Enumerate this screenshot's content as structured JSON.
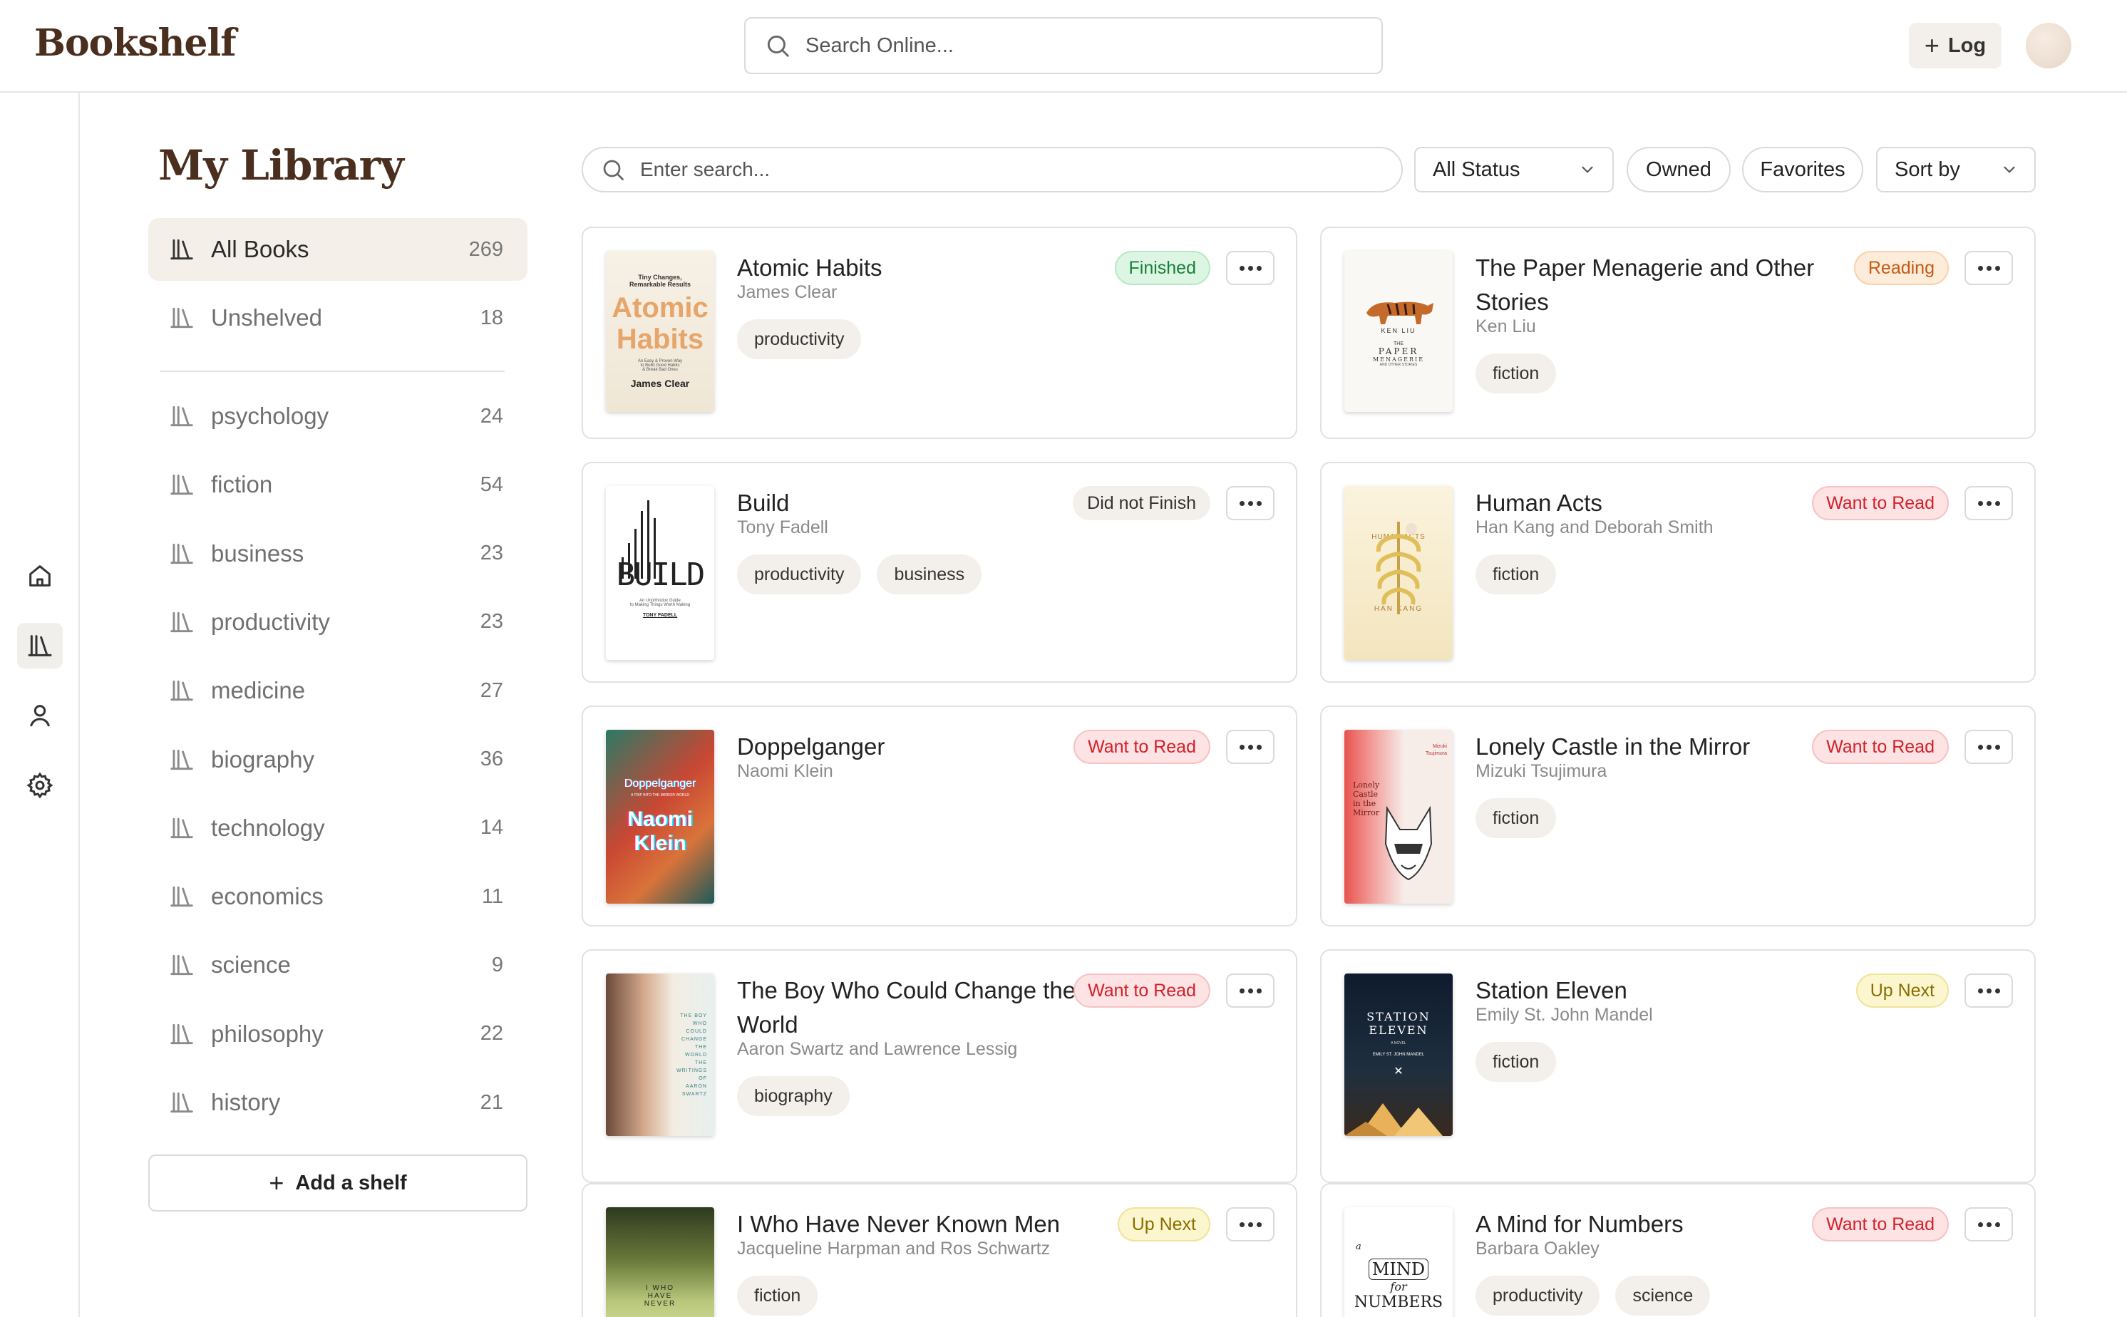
{
  "app": {
    "brand": "Bookshelf",
    "search_placeholder": "Search Online...",
    "log_label": "Log",
    "log_icon": "plus-icon"
  },
  "rail": {
    "items": [
      {
        "name": "home",
        "icon": "home-icon"
      },
      {
        "name": "library",
        "icon": "library-icon",
        "active": true
      },
      {
        "name": "profile",
        "icon": "user-icon"
      },
      {
        "name": "settings",
        "icon": "gear-icon"
      }
    ]
  },
  "sidebar": {
    "title": "My Library",
    "primary": [
      {
        "label": "All Books",
        "count": "269",
        "active": true
      },
      {
        "label": "Unshelved",
        "count": "18"
      }
    ],
    "shelves": [
      {
        "label": "psychology",
        "count": "24"
      },
      {
        "label": "fiction",
        "count": "54"
      },
      {
        "label": "business",
        "count": "23"
      },
      {
        "label": "productivity",
        "count": "23"
      },
      {
        "label": "medicine",
        "count": "27"
      },
      {
        "label": "biography",
        "count": "36"
      },
      {
        "label": "technology",
        "count": "14"
      },
      {
        "label": "economics",
        "count": "11"
      },
      {
        "label": "science",
        "count": "9"
      },
      {
        "label": "philosophy",
        "count": "22"
      },
      {
        "label": "history",
        "count": "21"
      }
    ],
    "add_label": "Add a shelf"
  },
  "filters": {
    "search_placeholder": "Enter search...",
    "status_value": "All Status",
    "owned_label": "Owned",
    "favorites_label": "Favorites",
    "sort_label": "Sort by"
  },
  "colors": {
    "brand": "#4a2f1f",
    "finished_bg": "#dcf6e3",
    "finished_text": "#1a7f3a",
    "finished_border": "#b7e8c5",
    "reading_bg": "#fdecd9",
    "reading_text": "#c45a14",
    "reading_border": "#f8d2ad",
    "dnf_bg": "#f3f0ec",
    "dnf_text": "#333333",
    "want_bg": "#fde3e3",
    "want_text": "#d1212a",
    "want_border": "#f6c2c2",
    "upnext_bg": "#fcf6cf",
    "upnext_text": "#8a6d00",
    "upnext_border": "#f0e39a"
  },
  "books": [
    {
      "title": "Atomic Habits",
      "author": "James Clear",
      "status": "Finished",
      "status_kind": "finished",
      "tags": [
        "productivity"
      ],
      "cover": {
        "lines": [
          "Tiny Changes,",
          "Remarkable Results",
          "Atomic",
          "Habits",
          "An Easy & Proven Way",
          "to Build Good Habits",
          "& Break Bad Ones",
          "James Clear"
        ]
      }
    },
    {
      "title": "The Paper Menagerie and Other Stories",
      "author": "Ken Liu",
      "status": "Reading",
      "status_kind": "reading",
      "tags": [
        "fiction"
      ],
      "cover": {
        "lines": [
          "KEN LIU",
          "THE",
          "PAPER",
          "MENAGERIE",
          "AND OTHER STORIES"
        ]
      }
    },
    {
      "title": "Build",
      "author": "Tony Fadell",
      "status": "Did not Finish",
      "status_kind": "dnf",
      "tags": [
        "productivity",
        "business"
      ],
      "cover": {
        "lines": [
          "BUILD",
          "An Unorthodox Guide",
          "to Making Things Worth Making",
          "TONY FADELL"
        ]
      }
    },
    {
      "title": "Human Acts",
      "author": "Han Kang and Deborah Smith",
      "status": "Want to Read",
      "status_kind": "want",
      "tags": [
        "fiction"
      ],
      "cover": {
        "lines": [
          "HUMAN ACTS",
          "HAN KANG"
        ]
      }
    },
    {
      "title": "Doppelganger",
      "author": "Naomi Klein",
      "status": "Want to Read",
      "status_kind": "want",
      "tags": [],
      "cover": {
        "lines": [
          "Doppelganger",
          "A TRIP INTO THE MIRROR WORLD",
          "Naomi",
          "Klein"
        ]
      }
    },
    {
      "title": "Lonely Castle in the Mirror",
      "author": "Mizuki Tsujimura",
      "status": "Want to Read",
      "status_kind": "want",
      "tags": [
        "fiction"
      ],
      "cover": {
        "lines": [
          "Lonely",
          "Castle",
          "in the",
          "Mirror",
          "Mizuki",
          "Tsujimura"
        ]
      }
    },
    {
      "title": "The Boy Who Could Change the World",
      "author": "Aaron Swartz and Lawrence Lessig",
      "status": "Want to Read",
      "status_kind": "want",
      "tags": [
        "biography"
      ],
      "cover": {
        "lines": [
          "THE BOY",
          "WHO",
          "COULD",
          "CHANGE",
          "THE",
          "WORLD",
          "THE",
          "WRITINGS",
          "OF",
          "AARON",
          "SWARTZ"
        ]
      }
    },
    {
      "title": "Station Eleven",
      "author": "Emily St. John Mandel",
      "status": "Up Next",
      "status_kind": "upnext",
      "tags": [
        "fiction"
      ],
      "cover": {
        "lines": [
          "STATION",
          "ELEVEN",
          "A NOVEL",
          "EMILY ST. JOHN MANDEL",
          "✕"
        ]
      }
    },
    {
      "title": "I Who Have Never Known Men",
      "author": "Jacqueline Harpman and Ros Schwartz",
      "status": "Up Next",
      "status_kind": "upnext",
      "tags": [
        "fiction"
      ],
      "cover": {
        "lines": [
          "I WHO",
          "HAVE",
          "NEVER"
        ]
      }
    },
    {
      "title": "A Mind for Numbers",
      "author": "Barbara Oakley",
      "status": "Want to Read",
      "status_kind": "want",
      "tags": [
        "productivity",
        "science"
      ],
      "cover": {
        "lines": [
          "a",
          "MIND",
          "for",
          "NUMBERS"
        ]
      }
    }
  ]
}
